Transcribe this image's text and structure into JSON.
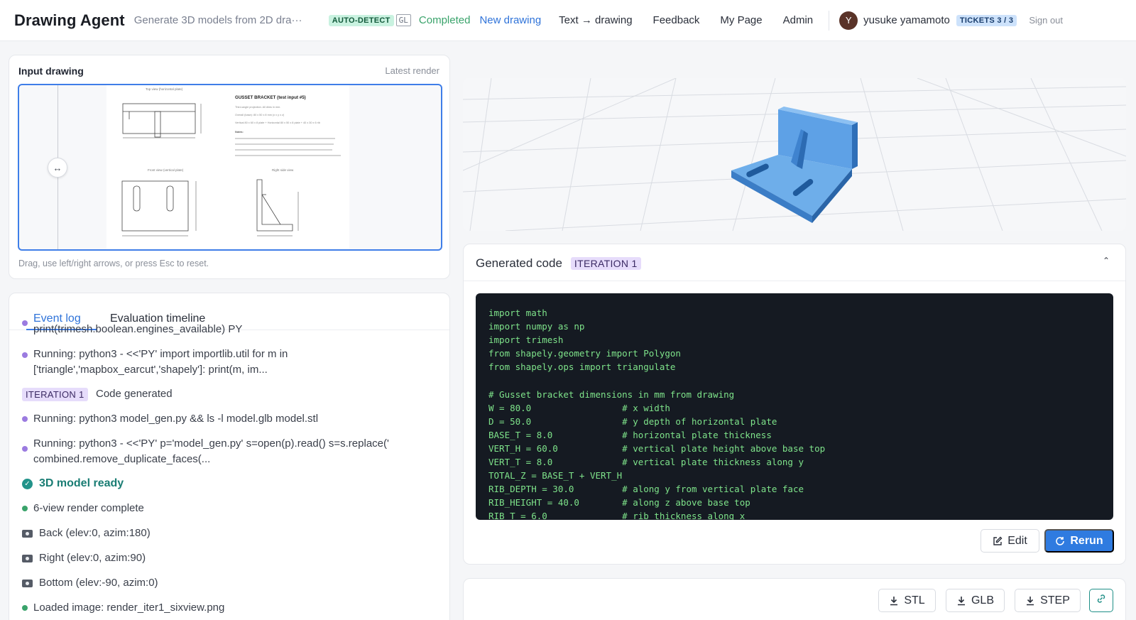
{
  "header": {
    "app_title": "Drawing Agent",
    "subtitle": "Generate 3D models from 2D dra···",
    "auto_detect_badge": "AUTO-DETECT",
    "gl_badge": "GL",
    "status": "Completed",
    "nav": {
      "new_drawing": "New drawing",
      "text_to_drawing": "Text → drawing",
      "feedback": "Feedback",
      "my_page": "My Page",
      "admin": "Admin"
    },
    "user": {
      "avatar_letter": "Y",
      "name": "yusuke yamamoto"
    },
    "tickets_badge": "TICKETS 3 / 3",
    "sign_out": "Sign out"
  },
  "input_card": {
    "title": "Input drawing",
    "meta": "Latest render",
    "drag_hint": "Drag, use left/right arrows, or press Esc to reset.",
    "split_handle": "↔",
    "drawing": {
      "top_view_label": "Top view (horizontal plate)",
      "heading": "GUSSET BRACKET (test input #5)",
      "lines": [
        "Third-angle projection. All dims in mm.",
        "Overall (base): 80 x 50 x 8 mm (x x y x z)",
        "Vertical 80 x 60 x 8 plate + Horizontal 80 x 50 x 8 plate + 40 x 30 x 6 rib"
      ],
      "notes_label": "Notes:",
      "front_view_label": "Front view (vertical plate)",
      "side_view_label": "Right side view"
    }
  },
  "log_card": {
    "tabs": [
      "Event log",
      "Evaluation timeline"
    ],
    "items": [
      {
        "kind": "purple",
        "text": "print(trimesh.boolean.engines_available) PY"
      },
      {
        "kind": "purple",
        "text": "Running: python3 - <<'PY' import importlib.util for m in ['triangle','mapbox_earcut','shapely']: print(m, im..."
      },
      {
        "kind": "iteration",
        "badge": "ITERATION 1",
        "text": "Code generated"
      },
      {
        "kind": "purple",
        "text": "Running: python3 model_gen.py && ls -l model.glb model.stl"
      },
      {
        "kind": "purple",
        "text": "Running: python3 - <<'PY' p='model_gen.py' s=open(p).read() s=s.replace(' combined.remove_duplicate_faces(..."
      },
      {
        "kind": "check",
        "text": "3D model ready"
      },
      {
        "kind": "green",
        "text": "6-view render complete"
      },
      {
        "kind": "camera",
        "text": "Back (elev:0, azim:180)"
      },
      {
        "kind": "camera",
        "text": "Right (elev:0, azim:90)"
      },
      {
        "kind": "camera",
        "text": "Bottom (elev:-90, azim:0)"
      },
      {
        "kind": "green",
        "text": "Loaded image: render_iter1_sixview.png"
      }
    ]
  },
  "code_card": {
    "title": "Generated code",
    "iteration_tag": "ITERATION 1",
    "lines": [
      "import math",
      "import numpy as np",
      "import trimesh",
      "from shapely.geometry import Polygon",
      "from shapely.ops import triangulate",
      "",
      "# Gusset bracket dimensions in mm from drawing",
      "W = 80.0                 # x width",
      "D = 50.0                 # y depth of horizontal plate",
      "BASE_T = 8.0             # horizontal plate thickness",
      "VERT_H = 60.0            # vertical plate height above base top",
      "VERT_T = 8.0             # vertical plate thickness along y",
      "TOTAL_Z = BASE_T + VERT_H",
      "RIB_DEPTH = 30.0         # along y from vertical plate face",
      "RIB_HEIGHT = 40.0        # along z above base top",
      "RIB_T = 6.0              # rib thickness along x"
    ],
    "edit_label": "Edit",
    "rerun_label": "Rerun"
  },
  "downloads": {
    "stl": "STL",
    "glb": "GLB",
    "step": "STEP"
  },
  "colors": {
    "accent": "#2f7be0",
    "model_blue": "#4a90d9",
    "code_bg": "#151a22",
    "code_text": "#7ee38a"
  }
}
